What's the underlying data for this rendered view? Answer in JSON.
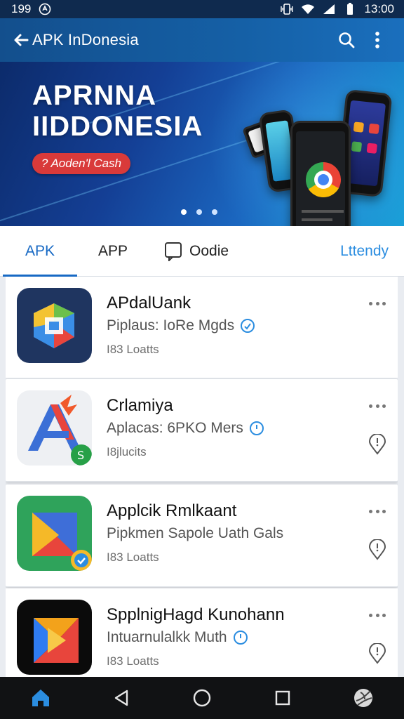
{
  "status_bar": {
    "time_left": "199",
    "time_right": "13:00"
  },
  "app_bar": {
    "title": "APK InDonesia"
  },
  "banner": {
    "title_line1": "APRNNA",
    "title_line2": "IIDDONESIA",
    "cta_label": "? Aoden'l Cash",
    "dots": 3,
    "active_dot": 1
  },
  "tabs": [
    {
      "label": "APK",
      "active": true
    },
    {
      "label": "APP",
      "active": false
    },
    {
      "label": "Oodie",
      "active": false
    },
    {
      "label": "Lttendy",
      "active": false
    }
  ],
  "apps": [
    {
      "name": "APdalUank",
      "subtitle": "Piplaus: IoRe Mgds",
      "meta": "I83 Loatts"
    },
    {
      "name": "Crlamiya",
      "subtitle": "Aplacas: 6PKO Mers",
      "meta": "I8jlucits"
    },
    {
      "name": "Applcik Rmlkaant",
      "subtitle": "Pipkmen Sapole Uath Gals",
      "meta": "I83 Loatts"
    },
    {
      "name": "SpplnigHagd Kunohann",
      "subtitle": "Intuarnulalkk Muth",
      "meta": "I83 Loatts"
    }
  ],
  "colors": {
    "accent": "#1769c4",
    "app_bar": "#1560a6",
    "cta": "#d93a3a",
    "nav_bar": "#111214"
  }
}
